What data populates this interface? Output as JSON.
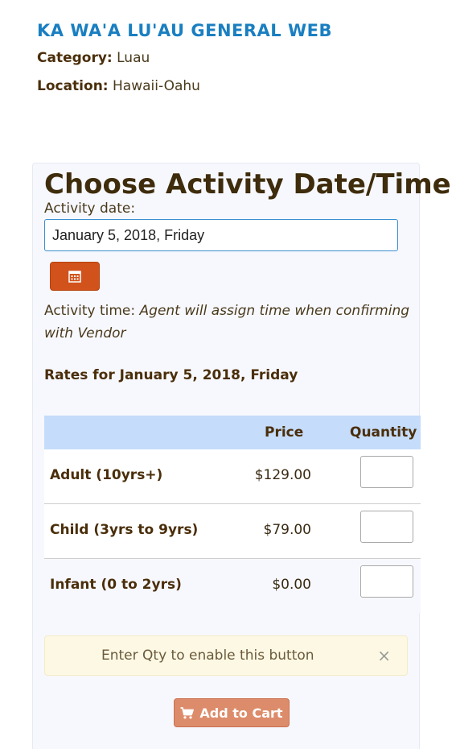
{
  "header": {
    "title": "KA WA'A LU'AU GENERAL WEB",
    "category_key": "Category:",
    "category_value": "Luau",
    "location_key": "Location:",
    "location_value": "Hawaii-Oahu"
  },
  "booking": {
    "heading": "Choose Activity Date/Time",
    "date_label": "Activity date:",
    "date_value": "January 5, 2018, Friday",
    "calendar_icon": "calendar-icon",
    "time_label": "Activity time:",
    "time_note": "Agent will assign time when confirming with Vendor",
    "rates_heading": "Rates for January 5, 2018, Friday"
  },
  "rates": {
    "columns": [
      "",
      "Price",
      "Quantity"
    ],
    "rows": [
      {
        "name": "Adult (10yrs+)",
        "price": "$129.00",
        "quantity": ""
      },
      {
        "name": "Child (3yrs to 9yrs)",
        "price": "$79.00",
        "quantity": ""
      },
      {
        "name": "Infant (0 to 2yrs)",
        "price": "$0.00",
        "quantity": ""
      }
    ]
  },
  "notice": {
    "text": "Enter Qty to enable this button",
    "close_glyph": "×"
  },
  "cart": {
    "label": "Add to Cart",
    "icon": "cart-icon"
  },
  "colors": {
    "title_blue": "#1a7fc1",
    "accent_orange": "#d2521c",
    "cart_disabled": "#dd8c6b",
    "table_header": "#c5dcfb",
    "notice_bg": "#fcf8e3"
  }
}
